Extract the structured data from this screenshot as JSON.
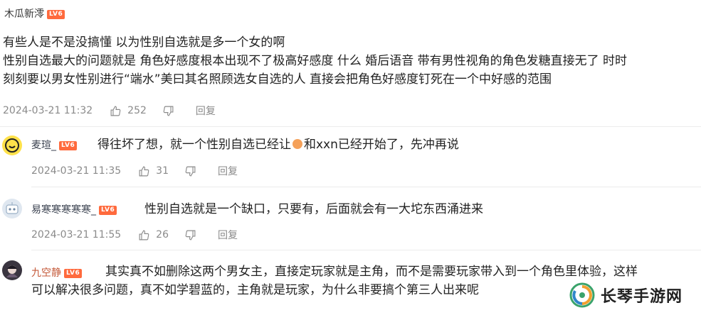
{
  "comments": [
    {
      "username": "木瓜新澪",
      "level": "LV6",
      "content_lines": [
        "有些人是不是没搞懂 以为性别自选就是多一个女的啊",
        "性别自选最大的问题就是 角色好感度根本出现不了极高好感度 什么 婚后语音  带有男性视角的角色发糖直接无了 时时",
        "刻刻要以男女性别进行“端水”美曰其名照顾选女自选的人 直接会把角色好感度钉死在一个中好感的范围"
      ],
      "date": "2024-03-21 11:32",
      "likes": "252",
      "reply": "回复"
    },
    {
      "username": "麦瑄_",
      "level": "LV6",
      "content_before": "得往坏了想，就一个性别自选已经让",
      "content_after": "和xxn已经开始了，先冲再说",
      "date": "2024-03-21 11:35",
      "likes": "31",
      "reply": "回复"
    },
    {
      "username": "易寒寒寒寒寒_",
      "level": "LV6",
      "content": "性别自选就是一个缺口，只要有，后面就会有一大坨东西涌进来",
      "date": "2024-03-21 11:55",
      "likes": "26",
      "reply": "回复"
    },
    {
      "username": "九空静",
      "level": "LV6",
      "content_lines": [
        "其实真不如删除这两个男女主，直接定玩家就是主角，而不是需要玩家带入到一个角色里体验，这样",
        "可以解决很多问题，真不如学碧蓝的，主角就是玩家，为什么非要搞个第三人出来呢"
      ]
    }
  ],
  "watermark": {
    "text": "长琴手游网"
  },
  "colors": {
    "level_badge": "#ff6a3d",
    "meta_text": "#8a8a8a",
    "accent_name": "#c45a3a"
  }
}
